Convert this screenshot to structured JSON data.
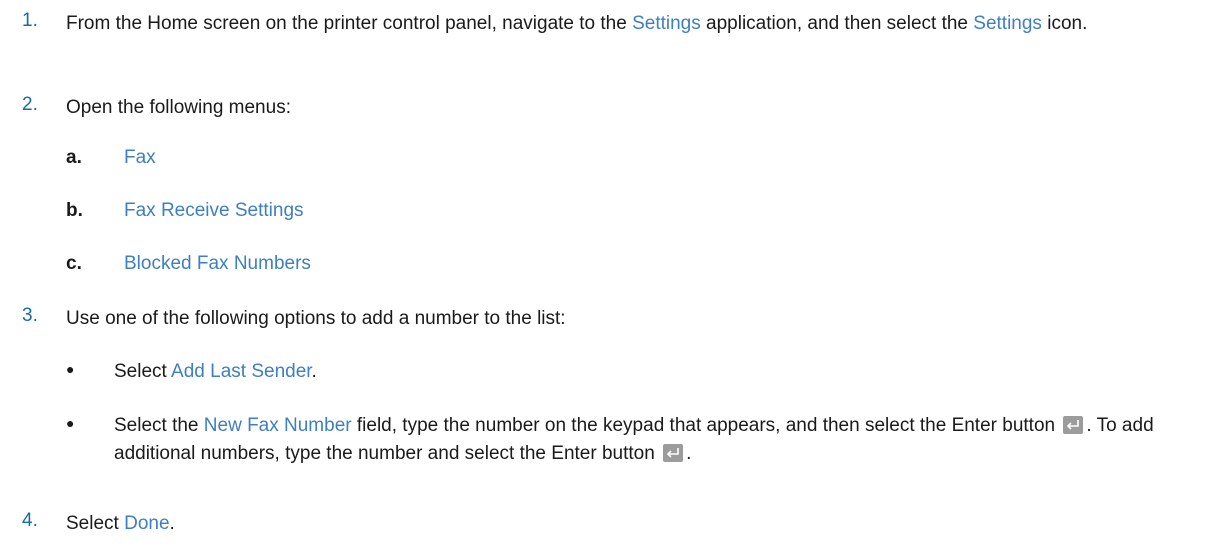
{
  "steps": [
    {
      "number": "1.",
      "before_1": "From the Home screen on the printer control panel, navigate to the ",
      "ui_1": "Settings",
      "between": " application, and then select the ",
      "ui_2": "Settings",
      "after": " icon."
    },
    {
      "number": "2.",
      "text": "Open the following menus:",
      "sub_items": [
        {
          "letter": "a.",
          "label": "Fax"
        },
        {
          "letter": "b.",
          "label": "Fax Receive Settings"
        },
        {
          "letter": "c.",
          "label": "Blocked Fax Numbers"
        }
      ]
    },
    {
      "number": "3.",
      "text": "Use one of the following options to add a number to the list:",
      "bullets": [
        {
          "symbol": "●",
          "prefix": "Select ",
          "ui": "Add Last Sender",
          "suffix": "."
        },
        {
          "symbol": "●",
          "prefix": "Select the ",
          "ui": "New Fax Number",
          "middle": " field, type the number on the keypad that appears, and then select the Enter button ",
          "middle_2": ". To add additional numbers, type the number and select the Enter button ",
          "suffix": "."
        }
      ]
    },
    {
      "number": "4.",
      "prefix": "Select ",
      "ui": "Done",
      "suffix": "."
    }
  ],
  "colors": {
    "ui_text": "#3d7fc0",
    "step_number": "#1a6aa6",
    "body_text": "#1a1a1a",
    "enter_icon_bg": "#9c9c9c"
  },
  "icons": {
    "enter_button": "enter-key-icon"
  }
}
